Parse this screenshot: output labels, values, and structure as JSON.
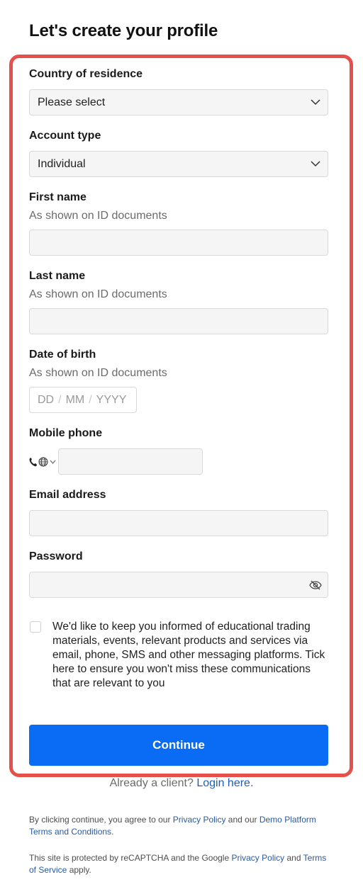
{
  "title": "Let's create your profile",
  "country": {
    "label": "Country of residence",
    "value": "Please select"
  },
  "account_type": {
    "label": "Account type",
    "value": "Individual"
  },
  "first_name": {
    "label": "First name",
    "hint": "As shown on ID documents",
    "value": ""
  },
  "last_name": {
    "label": "Last name",
    "hint": "As shown on ID documents",
    "value": ""
  },
  "dob": {
    "label": "Date of birth",
    "hint": "As shown on ID documents",
    "day": "DD",
    "month": "MM",
    "year": "YYYY",
    "separator": "/"
  },
  "phone": {
    "label": "Mobile phone",
    "value": ""
  },
  "email": {
    "label": "Email address",
    "value": ""
  },
  "password": {
    "label": "Password",
    "value": ""
  },
  "consent": {
    "checked": false,
    "text": "We'd like to keep you informed of educational trading materials, events, relevant products and services via email, phone, SMS and other messaging platforms. Tick here to ensure you won't miss these communications that are relevant to you"
  },
  "continue_label": "Continue",
  "login": {
    "prefix": "Already a client?",
    "link": "Login here",
    "suffix": "."
  },
  "legal": {
    "p1_a": "By clicking continue, you agree to our ",
    "privacy_link": "Privacy Policy",
    "p1_b": " and our ",
    "terms_link": "Demo Platform Terms and Conditions",
    "p1_c": ".",
    "p2_a": "This site is protected by reCAPTCHA and the Google ",
    "google_privacy_link": "Privacy Policy",
    "p2_b": " and ",
    "google_terms_link": "Terms of Service",
    "p2_c": " apply."
  },
  "colors": {
    "accent": "#0a6cf5",
    "frame": "#e5504b",
    "link": "#1d5fb8"
  },
  "icons": [
    "chevron-down-icon",
    "phone-icon",
    "globe-icon",
    "eye-off-icon"
  ]
}
